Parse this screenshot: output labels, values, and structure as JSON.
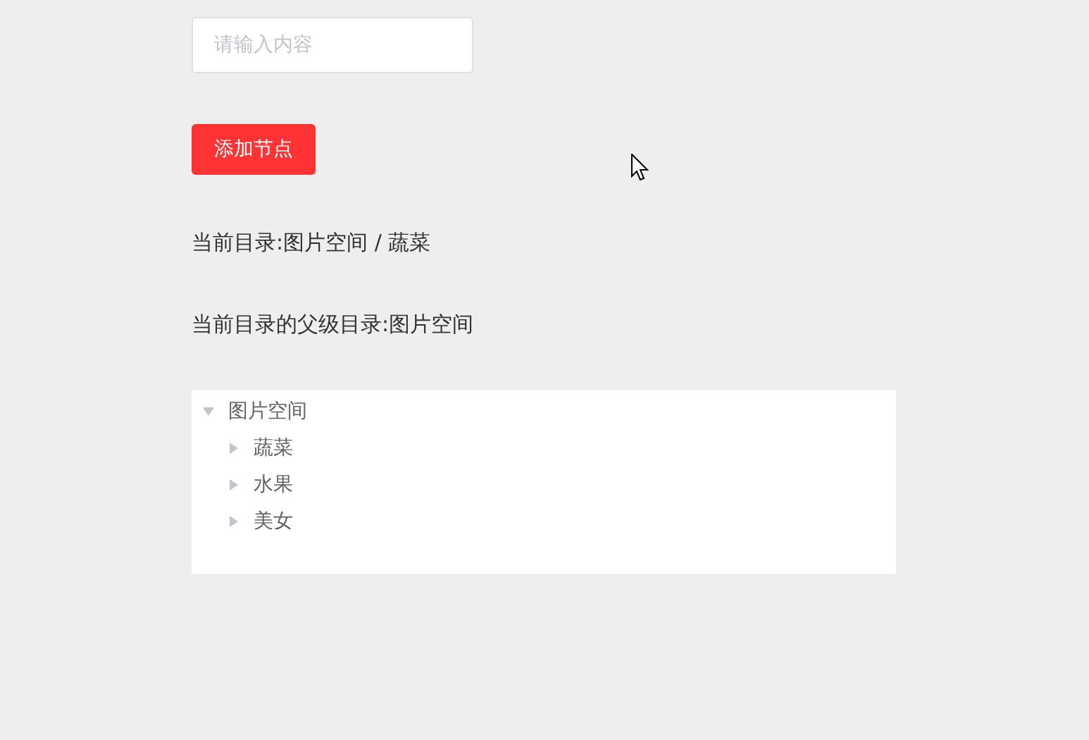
{
  "search": {
    "placeholder": "请输入内容"
  },
  "add_button": {
    "label": "添加节点"
  },
  "current_dir": {
    "label": "当前目录:",
    "value": "图片空间 / 蔬菜"
  },
  "parent_dir": {
    "label": "当前目录的父级目录:",
    "value": "图片空间"
  },
  "tree": [
    {
      "label": "图片空间",
      "expanded": true,
      "children": [
        {
          "label": "蔬菜",
          "expanded": false
        },
        {
          "label": "水果",
          "expanded": false
        },
        {
          "label": "美女",
          "expanded": false
        }
      ]
    }
  ]
}
